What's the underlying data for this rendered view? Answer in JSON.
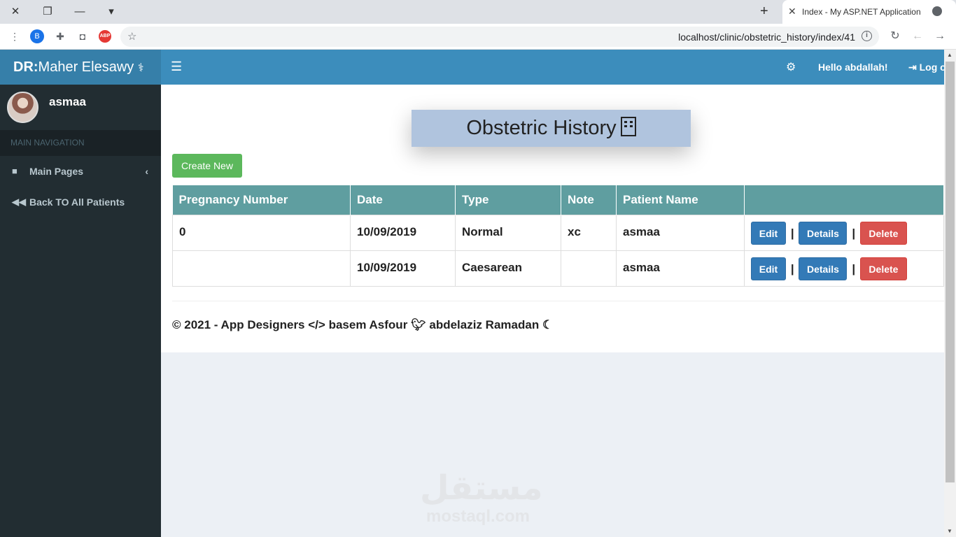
{
  "browser": {
    "tab_title": "Index - My ASP.NET Application",
    "url": "localhost/clinic/obstetric_history/index/41",
    "extension_b_label": "B",
    "extension_abp_label": "ABP"
  },
  "app": {
    "brand_bold": "DR:",
    "brand_name": "Maher Elesawy",
    "user_name": "asmaa",
    "nav_header": "MAIN NAVIGATION",
    "nav_items": [
      {
        "label": "Main Pages",
        "icon": "folder-icon"
      },
      {
        "label": "Back TO All Patients",
        "icon": "backward-icon"
      }
    ],
    "hello_text": "Hello abdallah!",
    "logoff_text": "Log off"
  },
  "page": {
    "title": "Obstetric History",
    "create_label": "Create New",
    "columns": [
      "Pregnancy Number",
      "Date",
      "Type",
      "Note",
      "Patient Name",
      ""
    ],
    "rows": [
      {
        "pregnancy_number": "0",
        "date": "10/09/2019",
        "type": "Normal",
        "note": "xc",
        "patient_name": "asmaa"
      },
      {
        "pregnancy_number": "",
        "date": "10/09/2019",
        "type": "Caesarean",
        "note": "",
        "patient_name": "asmaa"
      }
    ],
    "actions": {
      "edit": "Edit",
      "details": "Details",
      "delete": "Delete",
      "separator": "|"
    },
    "footer": {
      "copyright": "© 2021 - App Designers",
      "name1": "basem Asfour",
      "name2": "abdelaziz Ramadan"
    }
  },
  "watermark": {
    "arabic": "مستقل",
    "latin": "mostaql.com"
  },
  "colors": {
    "topbar": "#3c8dbc",
    "logo": "#367fa9",
    "sidebar": "#222d32",
    "table_header": "#5f9ea0",
    "title_bg": "#b0c4de",
    "create_button": "#5cb85c",
    "primary_button": "#337ab7",
    "danger_button": "#d9534f"
  }
}
